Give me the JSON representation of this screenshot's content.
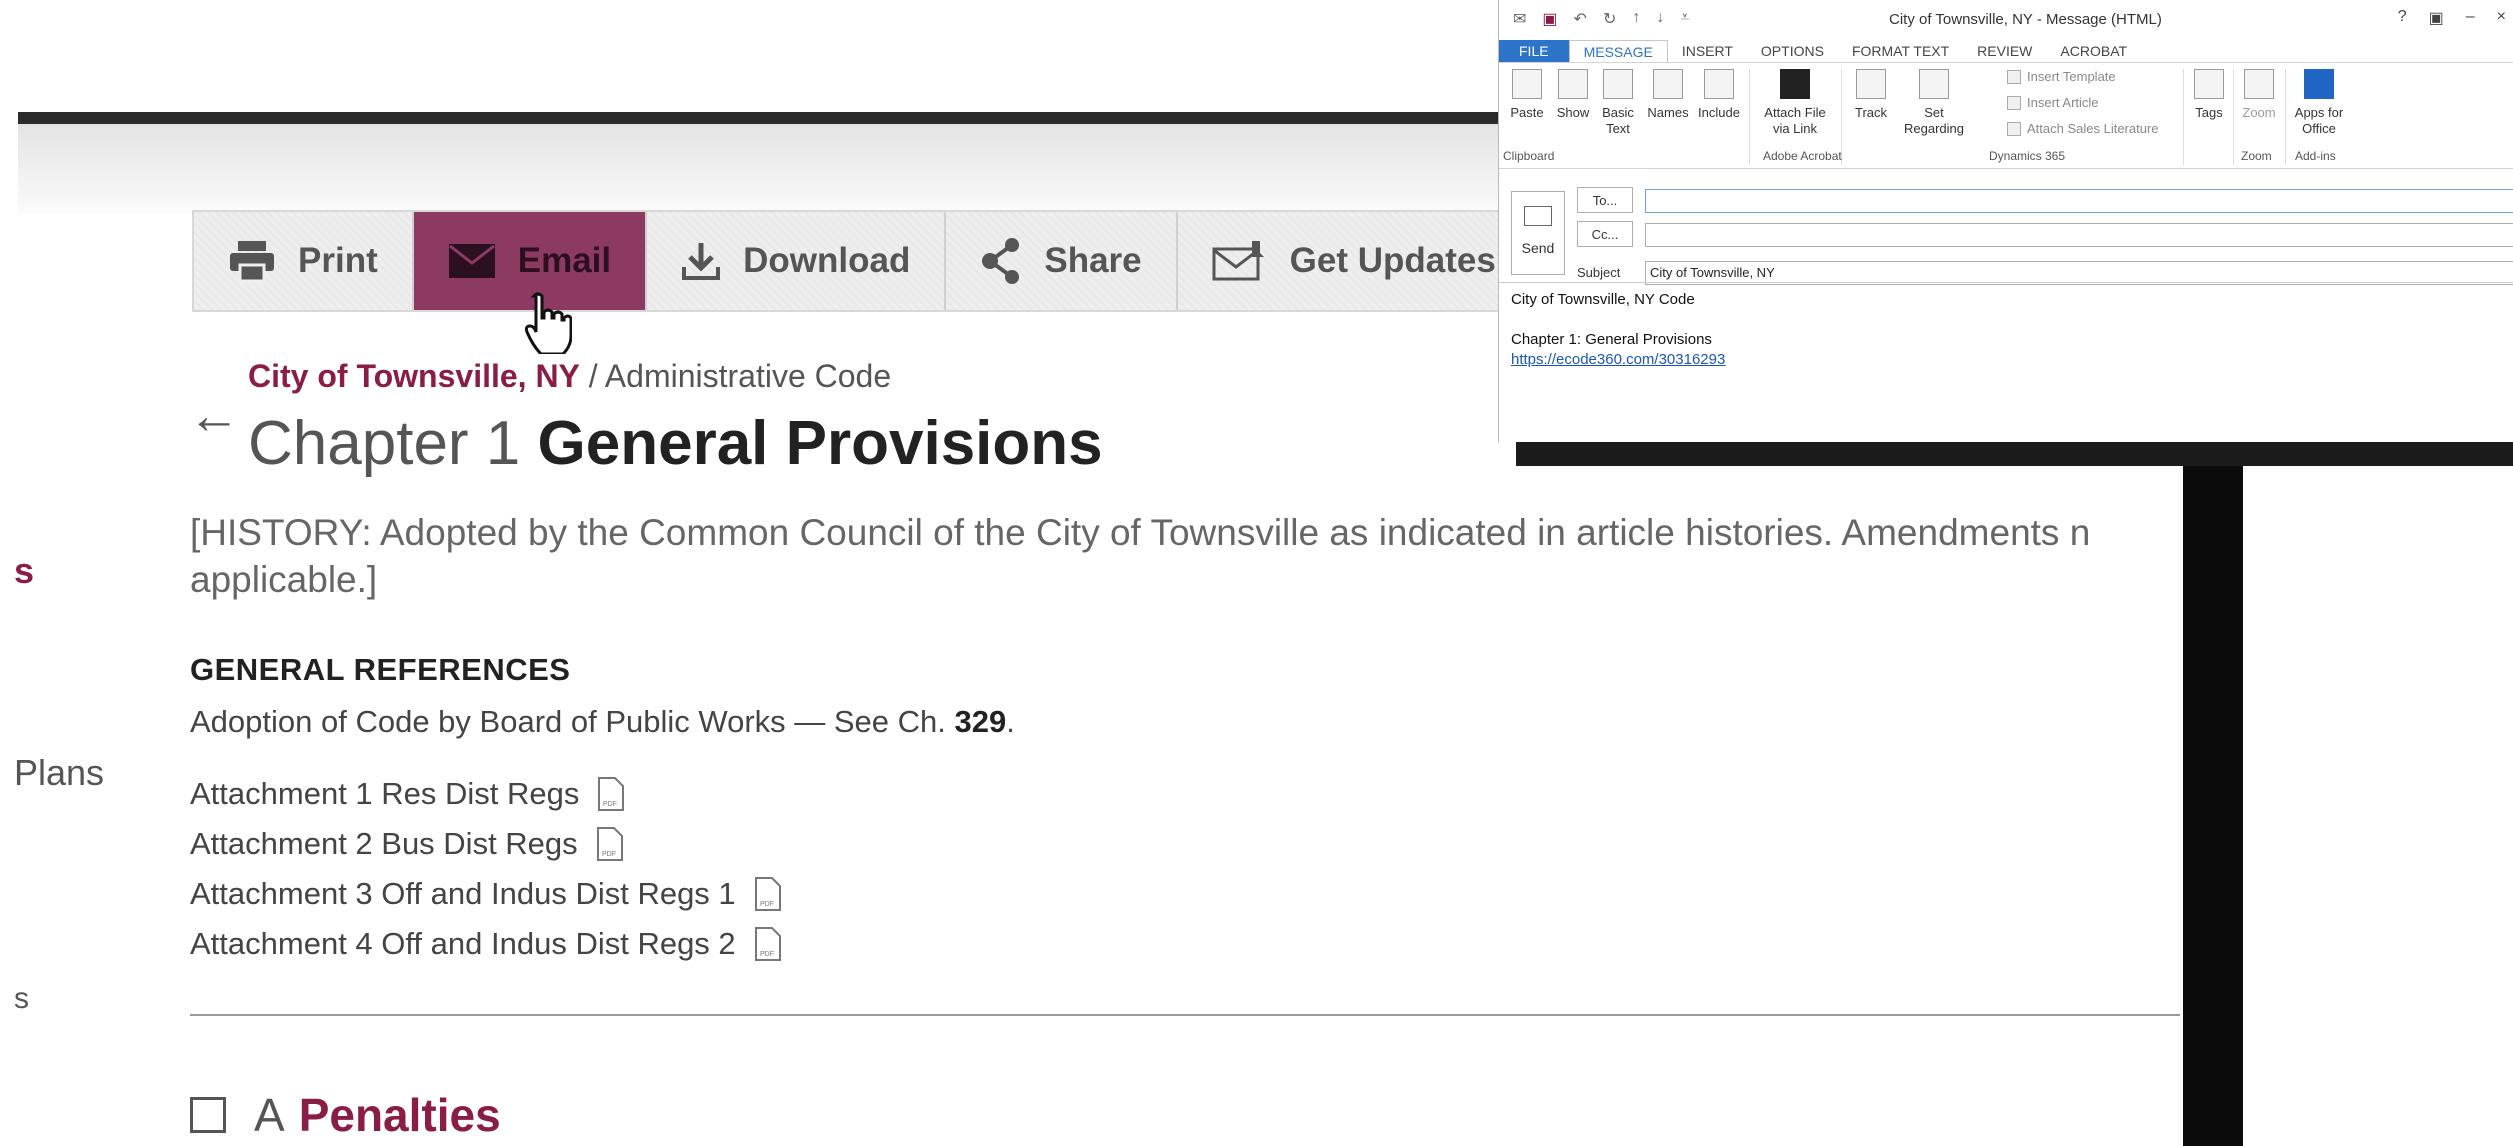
{
  "page": {
    "left_nav_fragments": [
      "s",
      "Plans",
      "s"
    ],
    "toolbar": {
      "print_label": "Print",
      "email_label": "Email",
      "download_label": "Download",
      "share_label": "Share",
      "updates_label": "Get Updates"
    },
    "breadcrumb": {
      "link": "City of Townsville, NY",
      "separator": "/",
      "current": "Administrative Code"
    },
    "chapter": {
      "prefix": "Chapter 1",
      "title": "General Provisions"
    },
    "history_line1": "[HISTORY: Adopted by the Common Council of the City of Townsville as indicated in article histories. Amendments n",
    "history_line2": "applicable.]",
    "general_references_heading": "GENERAL REFERENCES",
    "adoption_text": "Adoption of Code by Board of Public Works — See Ch.",
    "adoption_chapter": "329",
    "attachments": [
      "Attachment 1 Res Dist Regs",
      "Attachment 2 Bus Dist Regs",
      "Attachment 3 Off and Indus Dist Regs 1",
      "Attachment 4 Off and Indus Dist Regs 2"
    ],
    "section": {
      "letter": "A",
      "name": "Penalties"
    },
    "colors": {
      "brand": "#8a1c48",
      "active_button": "#8d3a63"
    }
  },
  "outlook": {
    "title": "City of Townsville, NY - Message (HTML)",
    "window_controls": [
      "?",
      "▣",
      "–",
      "×"
    ],
    "tabs": [
      "FILE",
      "MESSAGE",
      "INSERT",
      "OPTIONS",
      "FORMAT TEXT",
      "REVIEW",
      "ACROBAT"
    ],
    "selected_tab": "MESSAGE",
    "ribbon": {
      "paste": "Paste",
      "show": "Show",
      "basic_text_1": "Basic",
      "basic_text_2": "Text",
      "names": "Names",
      "include": "Include",
      "attach_link_1": "Attach File",
      "attach_link_2": "via Link",
      "track": "Track",
      "set_regarding_1": "Set",
      "set_regarding_2": "Regarding",
      "insert_template": "Insert Template",
      "insert_article": "Insert Article",
      "attach_sales": "Attach Sales Literature",
      "tags": "Tags",
      "zoom": "Zoom",
      "apps_1": "Apps for",
      "apps_2": "Office",
      "group_clipboard": "Clipboard",
      "group_adobe": "Adobe Acrobat",
      "group_dynamics": "Dynamics 365",
      "group_zoom": "Zoom",
      "group_addins": "Add-ins"
    },
    "compose": {
      "send": "Send",
      "to_button": "To...",
      "cc_button": "Cc...",
      "subject_label": "Subject",
      "to_value": "",
      "cc_value": "",
      "subject_value": "City of Townsville, NY"
    },
    "body": {
      "line1": "City of Townsville, NY Code",
      "line2": "Chapter 1: General Provisions",
      "link": "https://ecode360.com/30316293"
    }
  }
}
